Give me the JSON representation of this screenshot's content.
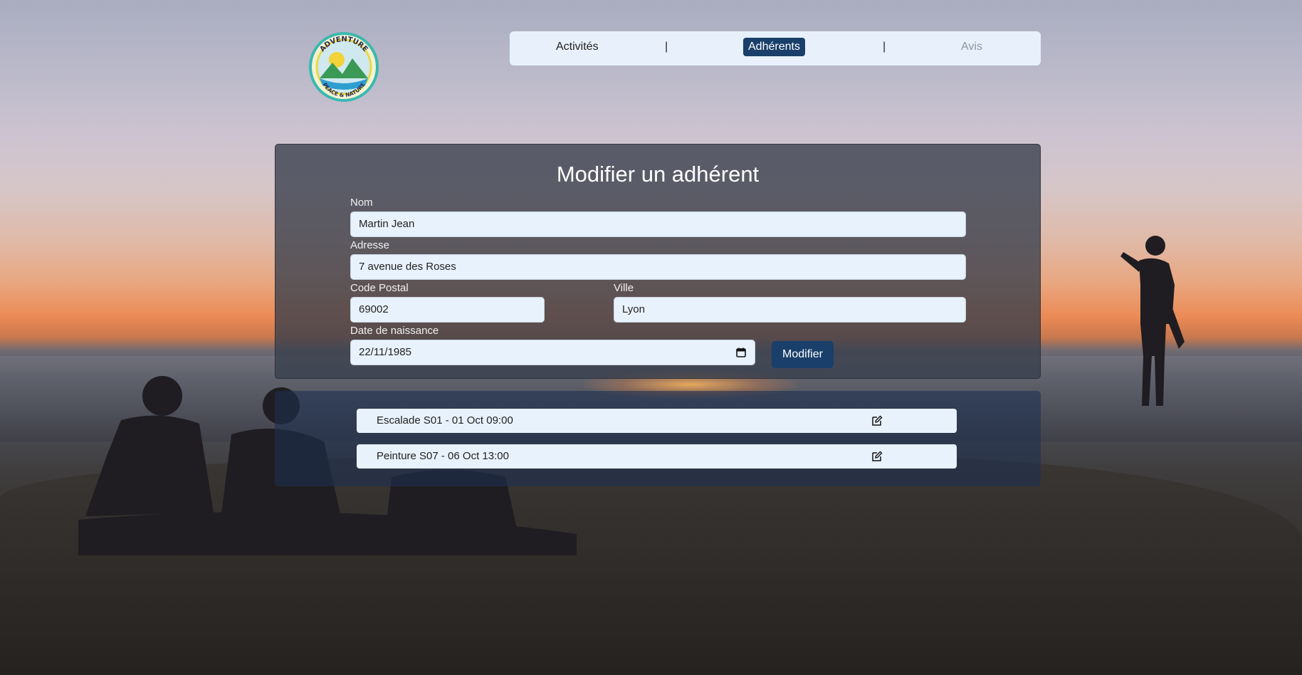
{
  "logo": {
    "top_text": "ADVENTURE",
    "bottom_text": "PEACE & NATURE"
  },
  "nav": {
    "items": [
      {
        "label": "Activités",
        "state": "default"
      },
      {
        "label": "Adhérents",
        "state": "active"
      },
      {
        "label": "Avis",
        "state": "muted"
      }
    ],
    "separator": "|"
  },
  "form": {
    "title": "Modifier un adhérent",
    "nom": {
      "label": "Nom",
      "value": "Martin Jean"
    },
    "adresse": {
      "label": "Adresse",
      "value": "7 avenue des Roses"
    },
    "code_postal": {
      "label": "Code Postal",
      "value": "69002"
    },
    "ville": {
      "label": "Ville",
      "value": "Lyon"
    },
    "date_naissance": {
      "label": "Date de naissance",
      "value": "22/11/1985"
    },
    "submit_label": "Modifier"
  },
  "activities": [
    {
      "label": "Escalade S01 - 01 Oct 09:00",
      "icon": "edit-icon"
    },
    {
      "label": "Peinture S07 - 06 Oct 13:00",
      "icon": "edit-icon"
    }
  ],
  "colors": {
    "accent": "#1a3f6a",
    "field_bg": "#e8f2fc",
    "nav_bg": "#e8f1fb"
  }
}
